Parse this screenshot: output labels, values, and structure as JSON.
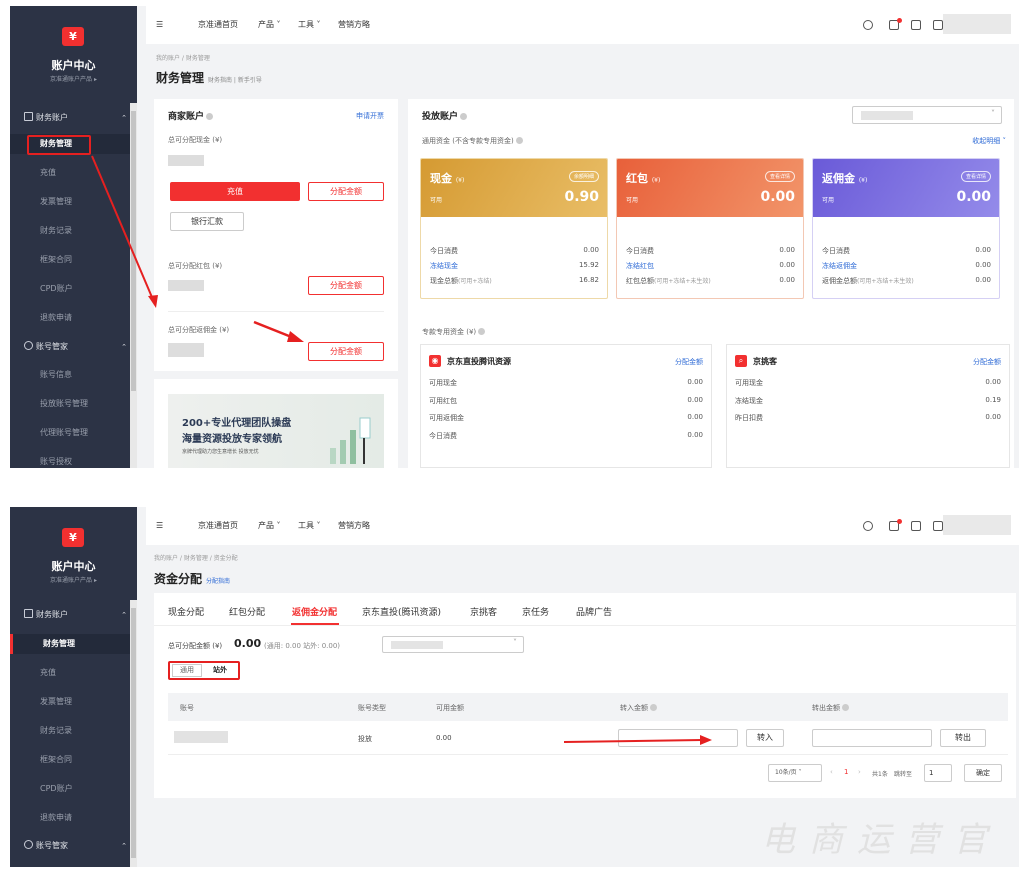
{
  "sidebar": {
    "title": "账户中心",
    "subtitle": "京准通账户产品 ▸",
    "groups": [
      {
        "label": "财务账户"
      },
      {
        "label": "账号管家"
      }
    ],
    "finance_items": [
      "财务管理",
      "充值",
      "发票管理",
      "财务记录",
      "框架合同",
      "CPD账户",
      "退款申请"
    ],
    "account_items": [
      "账号信息",
      "投放账号管理",
      "代理账号管理",
      "账号授权"
    ]
  },
  "topbar": {
    "nav": [
      "京准通首页",
      "产品",
      "工具",
      "营销方略"
    ]
  },
  "page1": {
    "breadcrumb": "我的账户 / 财务管理",
    "title": "财务管理",
    "help_links": "财务指南 | 新手引导",
    "merchant": {
      "title": "商家账户",
      "apply_link": "申请开票",
      "cash_label": "总可分配现金 (¥)",
      "recharge": "充值",
      "allocate": "分配金额",
      "bank": "银行汇款",
      "redpack_label": "总可分配红包 (¥)",
      "rebate_label": "总可分配返佣金 (¥)"
    },
    "banner": {
      "line1": "200+专业代理团队操盘",
      "line2": "海量资源投放专家领航",
      "line3": "京牌代理助力您生意增长 投放无忧"
    },
    "delivery": {
      "title": "投放账户",
      "general_label": "通用资金 (不含专款专用资金)",
      "collapse": "收起明细",
      "cards": [
        {
          "name": "现金",
          "unit": "(¥)",
          "badge": "余额明细",
          "avail": "可用",
          "amount": "0.90",
          "rows": [
            {
              "k": "今日消费",
              "v": "0.00"
            },
            {
              "k": "冻结现金",
              "v": "15.92"
            },
            {
              "k": "现金总额",
              "note": "(可用+冻结)",
              "v": "16.82"
            }
          ]
        },
        {
          "name": "红包",
          "unit": "(¥)",
          "badge": "查看详情",
          "avail": "可用",
          "amount": "0.00",
          "rows": [
            {
              "k": "今日消费",
              "v": "0.00"
            },
            {
              "k": "冻结红包",
              "v": "0.00"
            },
            {
              "k": "红包总额",
              "note": "(可用+冻结+未生效)",
              "v": "0.00"
            }
          ]
        },
        {
          "name": "返佣金",
          "unit": "(¥)",
          "badge": "查看详情",
          "avail": "可用",
          "amount": "0.00",
          "rows": [
            {
              "k": "今日消费",
              "v": "0.00"
            },
            {
              "k": "冻结返佣金",
              "v": "0.00"
            },
            {
              "k": "返佣金总额",
              "note": "(可用+冻结+未生效)",
              "v": "0.00"
            }
          ]
        }
      ],
      "special_label": "专款专用资金 (¥)",
      "special": [
        {
          "name": "京东直投腾讯资源",
          "action": "分配金额",
          "rows": [
            {
              "k": "可用现金",
              "v": "0.00"
            },
            {
              "k": "可用红包",
              "v": "0.00"
            },
            {
              "k": "可用返佣金",
              "v": "0.00"
            },
            {
              "k": "今日消费",
              "v": "0.00"
            }
          ]
        },
        {
          "name": "京挑客",
          "action": "分配金额",
          "rows": [
            {
              "k": "可用现金",
              "v": "0.00"
            },
            {
              "k": "冻结现金",
              "v": "0.19"
            },
            {
              "k": "昨日扣费",
              "v": "0.00"
            }
          ]
        }
      ]
    }
  },
  "page2": {
    "breadcrumb": "我的账户 / 财务管理 / 资金分配",
    "title": "资金分配",
    "help_link": "分配指南",
    "tabs": [
      "现金分配",
      "红包分配",
      "返佣金分配",
      "京东直投(腾讯资源)",
      "京挑客",
      "京任务",
      "品牌广告"
    ],
    "total_label": "总可分配金额 (¥)",
    "total_value": "0.00",
    "total_detail": "(通用: 0.00 站外: 0.00)",
    "toggle": [
      "通用",
      "站外"
    ],
    "table": {
      "headers": [
        "账号",
        "账号类型",
        "可用金额",
        "转入金额",
        "转出金额"
      ],
      "row": {
        "type": "投放",
        "available": "0.00"
      },
      "transfer_in": "转入",
      "transfer_out": "转出"
    },
    "pager": {
      "size": "10条/页",
      "page": "1",
      "total": "共1条",
      "goto": "跳转至",
      "goto_value": "1",
      "confirm": "确定"
    },
    "watermark": "电商运营官"
  },
  "colors": {
    "brand_red": "#f23030",
    "sidebar": "#2c3345",
    "gold": "#d9a53c",
    "orange": "#ec6a3a",
    "purple": "#7a6fe0",
    "link": "#2f6bd6"
  }
}
